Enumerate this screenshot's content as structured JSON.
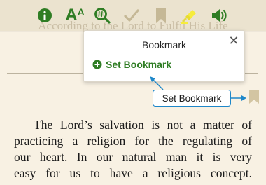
{
  "toolbar": {
    "icons": [
      "info-icon",
      "font-size-icon",
      "search-icon",
      "check-icon",
      "bookmark-icon",
      "highlighter-icon",
      "speaker-icon"
    ],
    "font_size_label": "A",
    "font_size_superscript": "A"
  },
  "heading": {
    "text": "According to the Lord to Fulfil His Life"
  },
  "bookmark_popup": {
    "title": "Bookmark",
    "close_glyph": "✕",
    "action_label": "Set Bookmark"
  },
  "callout": {
    "label": "Set Bookmark"
  },
  "body": {
    "lines": [
      "The Lord’s salvation is not a matter of",
      "practicing a religion for the regulating of",
      "our heart. In our natural man it is very",
      "easy for us to have a religious concept."
    ]
  },
  "colors": {
    "icon_green": "#2f7d24",
    "icon_disabled": "#c5b896",
    "highlighter_yellow": "#f6ec3c",
    "callout_blue": "#1e87c9",
    "page_background": "#f8f1e3",
    "toolbar_background": "#ebe3cf"
  }
}
